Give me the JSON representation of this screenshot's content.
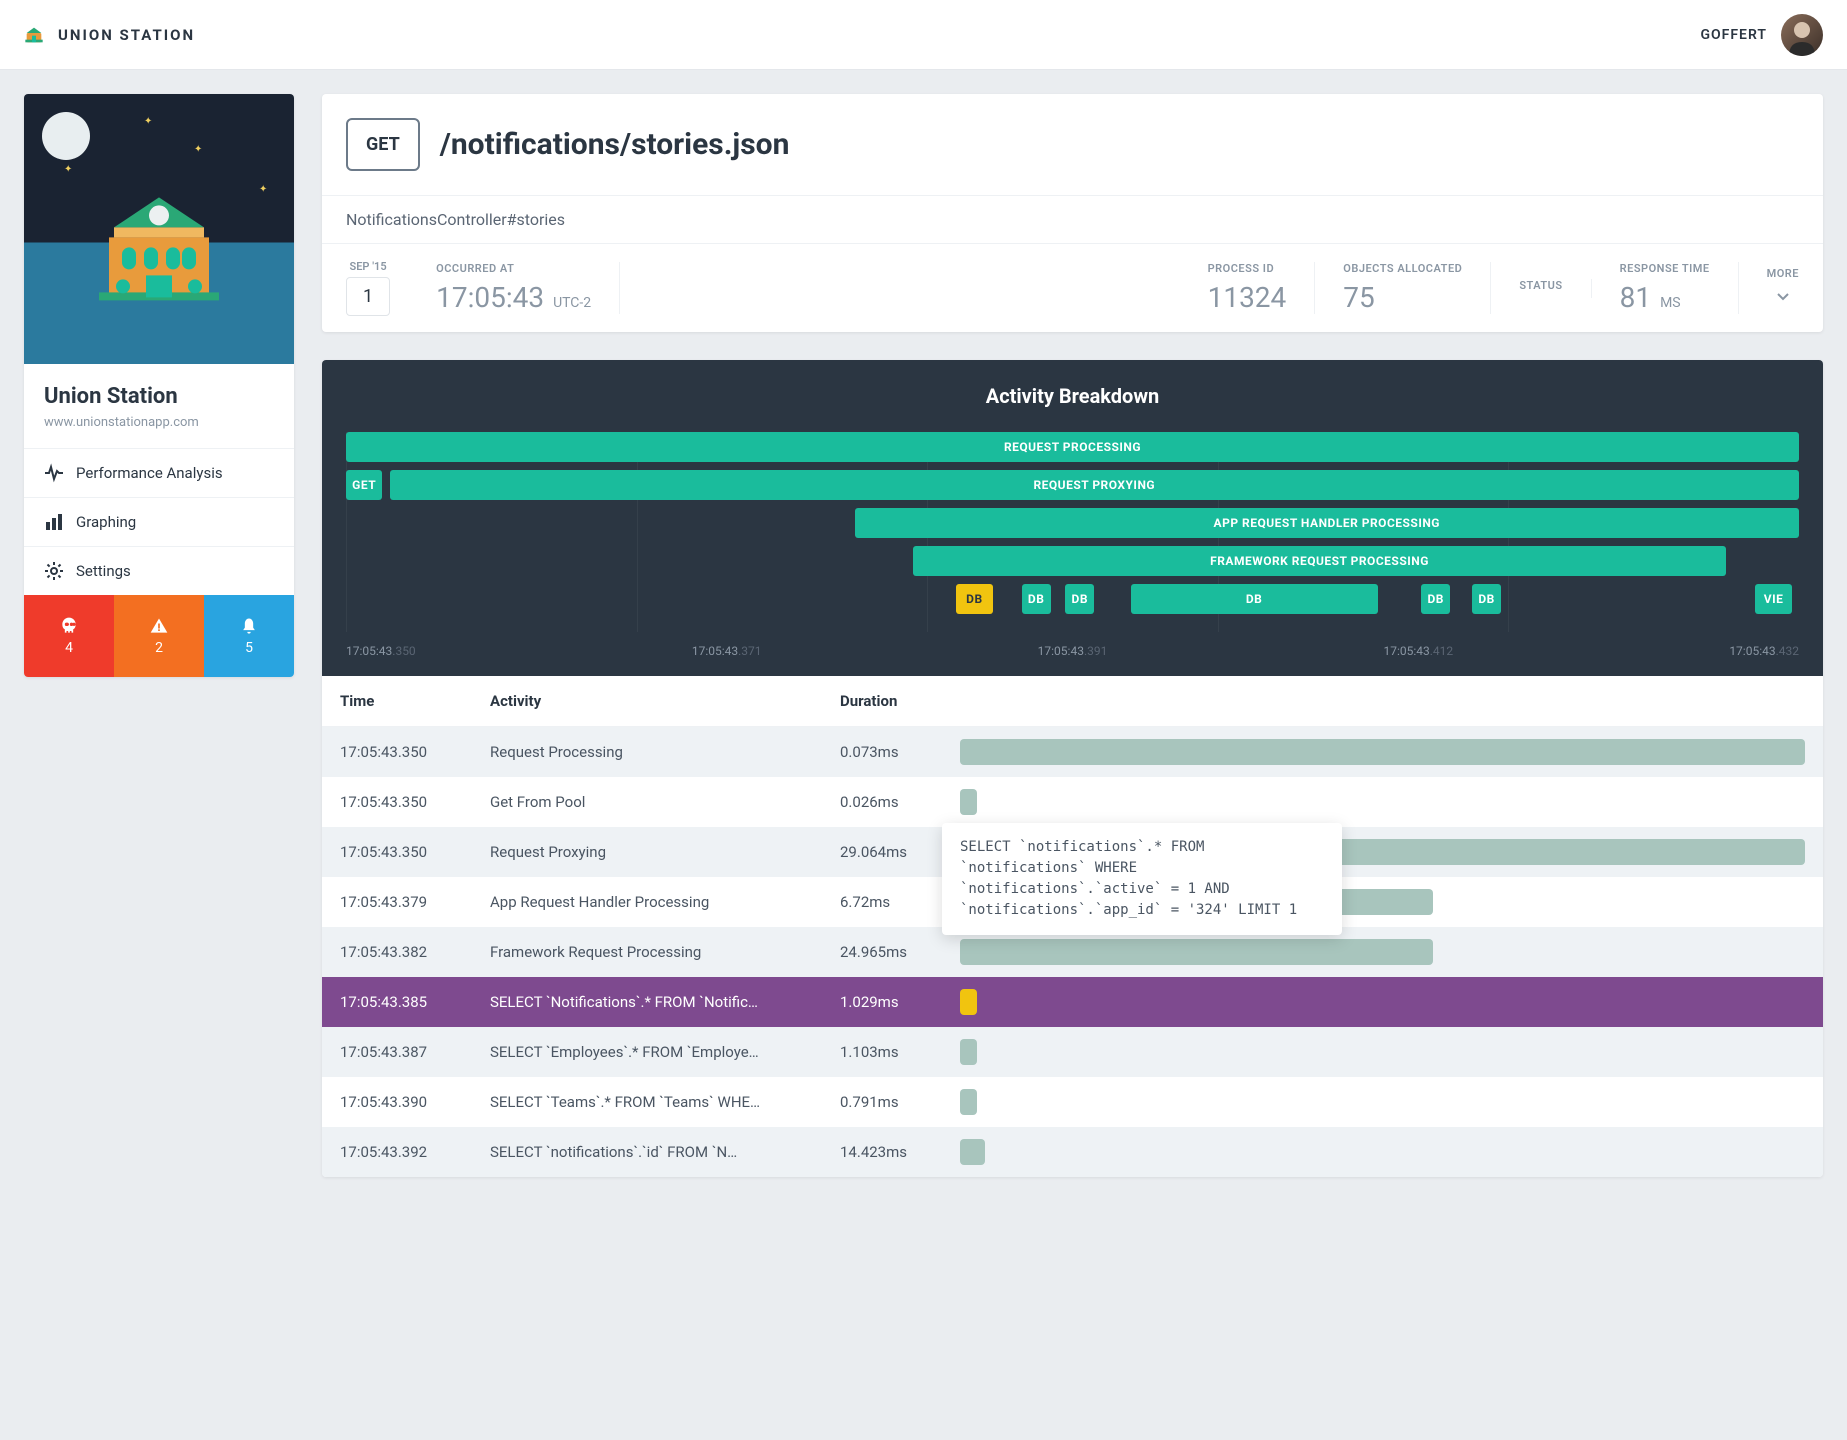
{
  "brand": "UNION STATION",
  "user": {
    "name": "GOFFERT"
  },
  "sidebar": {
    "title": "Union Station",
    "subtitle": "www.unionstationapp.com",
    "nav": [
      {
        "label": "Performance Analysis"
      },
      {
        "label": "Graphing"
      },
      {
        "label": "Settings"
      }
    ],
    "alerts": {
      "red": "4",
      "orange": "2",
      "blue": "5"
    }
  },
  "request": {
    "method": "GET",
    "path": "/notifications/stories.json",
    "controller": "NotificationsController#stories",
    "date_month": "SEP '15",
    "date_day": "1",
    "occurred_label": "OCCURRED AT",
    "occurred_value": "17:05:43",
    "occurred_tz": "UTC-2",
    "process_label": "PROCESS ID",
    "process_value": "11324",
    "objects_label": "OBJECTS ALLOCATED",
    "objects_value": "75",
    "status_label": "STATUS",
    "status_value": "",
    "response_label": "RESPONSE TIME",
    "response_value": "81",
    "response_unit": "MS",
    "more_label": "MORE"
  },
  "breakdown": {
    "title": "Activity Breakdown",
    "ticks": [
      {
        "t": "17:05:43",
        "ms": ".350"
      },
      {
        "t": "17:05:43",
        "ms": ".371"
      },
      {
        "t": "17:05:43",
        "ms": ".391"
      },
      {
        "t": "17:05:43",
        "ms": ".412"
      },
      {
        "t": "17:05:43",
        "ms": ".432"
      }
    ]
  },
  "chart_data": {
    "type": "bar",
    "title": "Activity Breakdown",
    "xlabel": "time",
    "x_range": [
      "17:05:43.350",
      "17:05:43.432"
    ],
    "bars": [
      {
        "label": "REQUEST PROCESSING",
        "row": 0,
        "left_pct": 0,
        "width_pct": 100,
        "color": "teal"
      },
      {
        "label": "GET",
        "row": 1,
        "left_pct": 0,
        "width_pct": 2.5,
        "color": "teal"
      },
      {
        "label": "REQUEST PROXYING",
        "row": 1,
        "left_pct": 3,
        "width_pct": 97,
        "color": "teal"
      },
      {
        "label": "APP REQUEST HANDLER PROCESSING",
        "row": 2,
        "left_pct": 35,
        "width_pct": 65,
        "color": "teal"
      },
      {
        "label": "FRAMEWORK REQUEST PROCESSING",
        "row": 3,
        "left_pct": 39,
        "width_pct": 56,
        "color": "teal"
      },
      {
        "label": "DB",
        "row": 4,
        "left_pct": 42,
        "width_pct": 2.5,
        "color": "yellow"
      },
      {
        "label": "DB",
        "row": 4,
        "left_pct": 46.5,
        "width_pct": 2,
        "color": "teal"
      },
      {
        "label": "DB",
        "row": 4,
        "left_pct": 49.5,
        "width_pct": 2,
        "color": "teal"
      },
      {
        "label": "DB",
        "row": 4,
        "left_pct": 54,
        "width_pct": 17,
        "color": "teal"
      },
      {
        "label": "DB",
        "row": 4,
        "left_pct": 74,
        "width_pct": 2,
        "color": "teal"
      },
      {
        "label": "DB",
        "row": 4,
        "left_pct": 77.5,
        "width_pct": 2,
        "color": "teal"
      },
      {
        "label": "VIE",
        "row": 4,
        "left_pct": 97,
        "width_pct": 2.5,
        "color": "teal"
      }
    ]
  },
  "table": {
    "headers": [
      "Time",
      "Activity",
      "Duration"
    ],
    "rows": [
      {
        "time": "17:05:43.350",
        "activity": "Request Processing",
        "duration": "0.073ms",
        "bar_pct": 100,
        "bar_color": "grey",
        "even": true
      },
      {
        "time": "17:05:43.350",
        "activity": "Get From Pool",
        "duration": "0.026ms",
        "bar_pct": 2,
        "bar_color": "grey"
      },
      {
        "time": "17:05:43.350",
        "activity": "Request Proxying",
        "duration": "29.064ms",
        "bar_pct": 100,
        "bar_color": "grey",
        "even": true
      },
      {
        "time": "17:05:43.379",
        "activity": "App Request Handler Processing",
        "duration": "6.72ms",
        "bar_pct": 56,
        "bar_color": "grey",
        "has_tooltip": true
      },
      {
        "time": "17:05:43.382",
        "activity": "Framework Request Processing",
        "duration": "24.965ms",
        "bar_pct": 56,
        "bar_color": "grey",
        "even": true
      },
      {
        "time": "17:05:43.385",
        "activity": "SELECT `Notifications`.* FROM `Notific…",
        "duration": "1.029ms",
        "bar_pct": 2,
        "bar_color": "yellow",
        "selected": true
      },
      {
        "time": "17:05:43.387",
        "activity": "SELECT `Employees`.* FROM `Employe…",
        "duration": "1.103ms",
        "bar_pct": 2,
        "bar_color": "grey",
        "even": true
      },
      {
        "time": "17:05:43.390",
        "activity": "SELECT `Teams`.* FROM `Teams` WHE…",
        "duration": "0.791ms",
        "bar_pct": 2,
        "bar_color": "grey"
      },
      {
        "time": "17:05:43.392",
        "activity": "SELECT `notifications`.`id` FROM `N…",
        "duration": "14.423ms",
        "bar_pct": 3,
        "bar_color": "grey",
        "even": true
      }
    ]
  },
  "tooltip": "SELECT `notifications`.* FROM `notifications` WHERE `notifications`.`active` = 1 AND `notifications`.`app_id` = '324' LIMIT 1"
}
